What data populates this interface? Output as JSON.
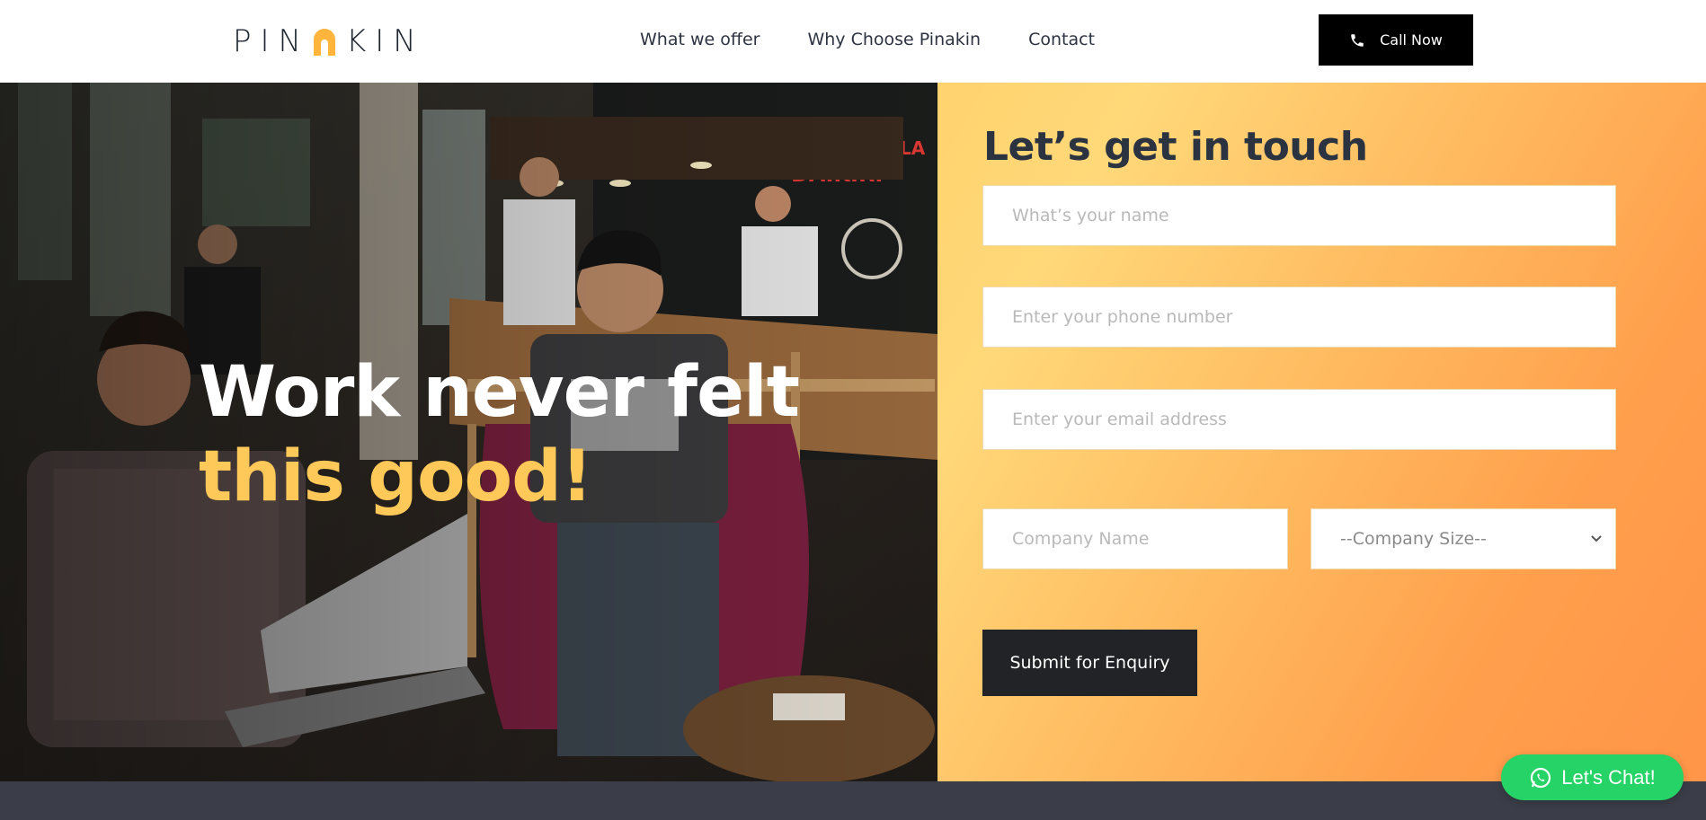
{
  "header": {
    "logo_left": "PIN",
    "logo_right": "KIN",
    "nav": [
      {
        "label": "What we offer"
      },
      {
        "label": "Why Choose Pinakin"
      },
      {
        "label": "Contact"
      }
    ],
    "call_label": "Call Now"
  },
  "hero": {
    "title_line1": "Work never felt",
    "title_line2": "this good!"
  },
  "contact": {
    "heading": "Let’s get in touch",
    "name_placeholder": "What’s your name",
    "phone_placeholder": "Enter your phone number",
    "email_placeholder": "Enter your email address",
    "company_placeholder": "Company Name",
    "size_selected": "--Company Size--",
    "submit_label": "Submit for Enquiry"
  },
  "chat": {
    "label": "Let's Chat!"
  },
  "colors": {
    "accent": "#ffc95a",
    "chat_green": "#25d366",
    "dark_button": "#222326",
    "footer": "#3b3e48"
  }
}
